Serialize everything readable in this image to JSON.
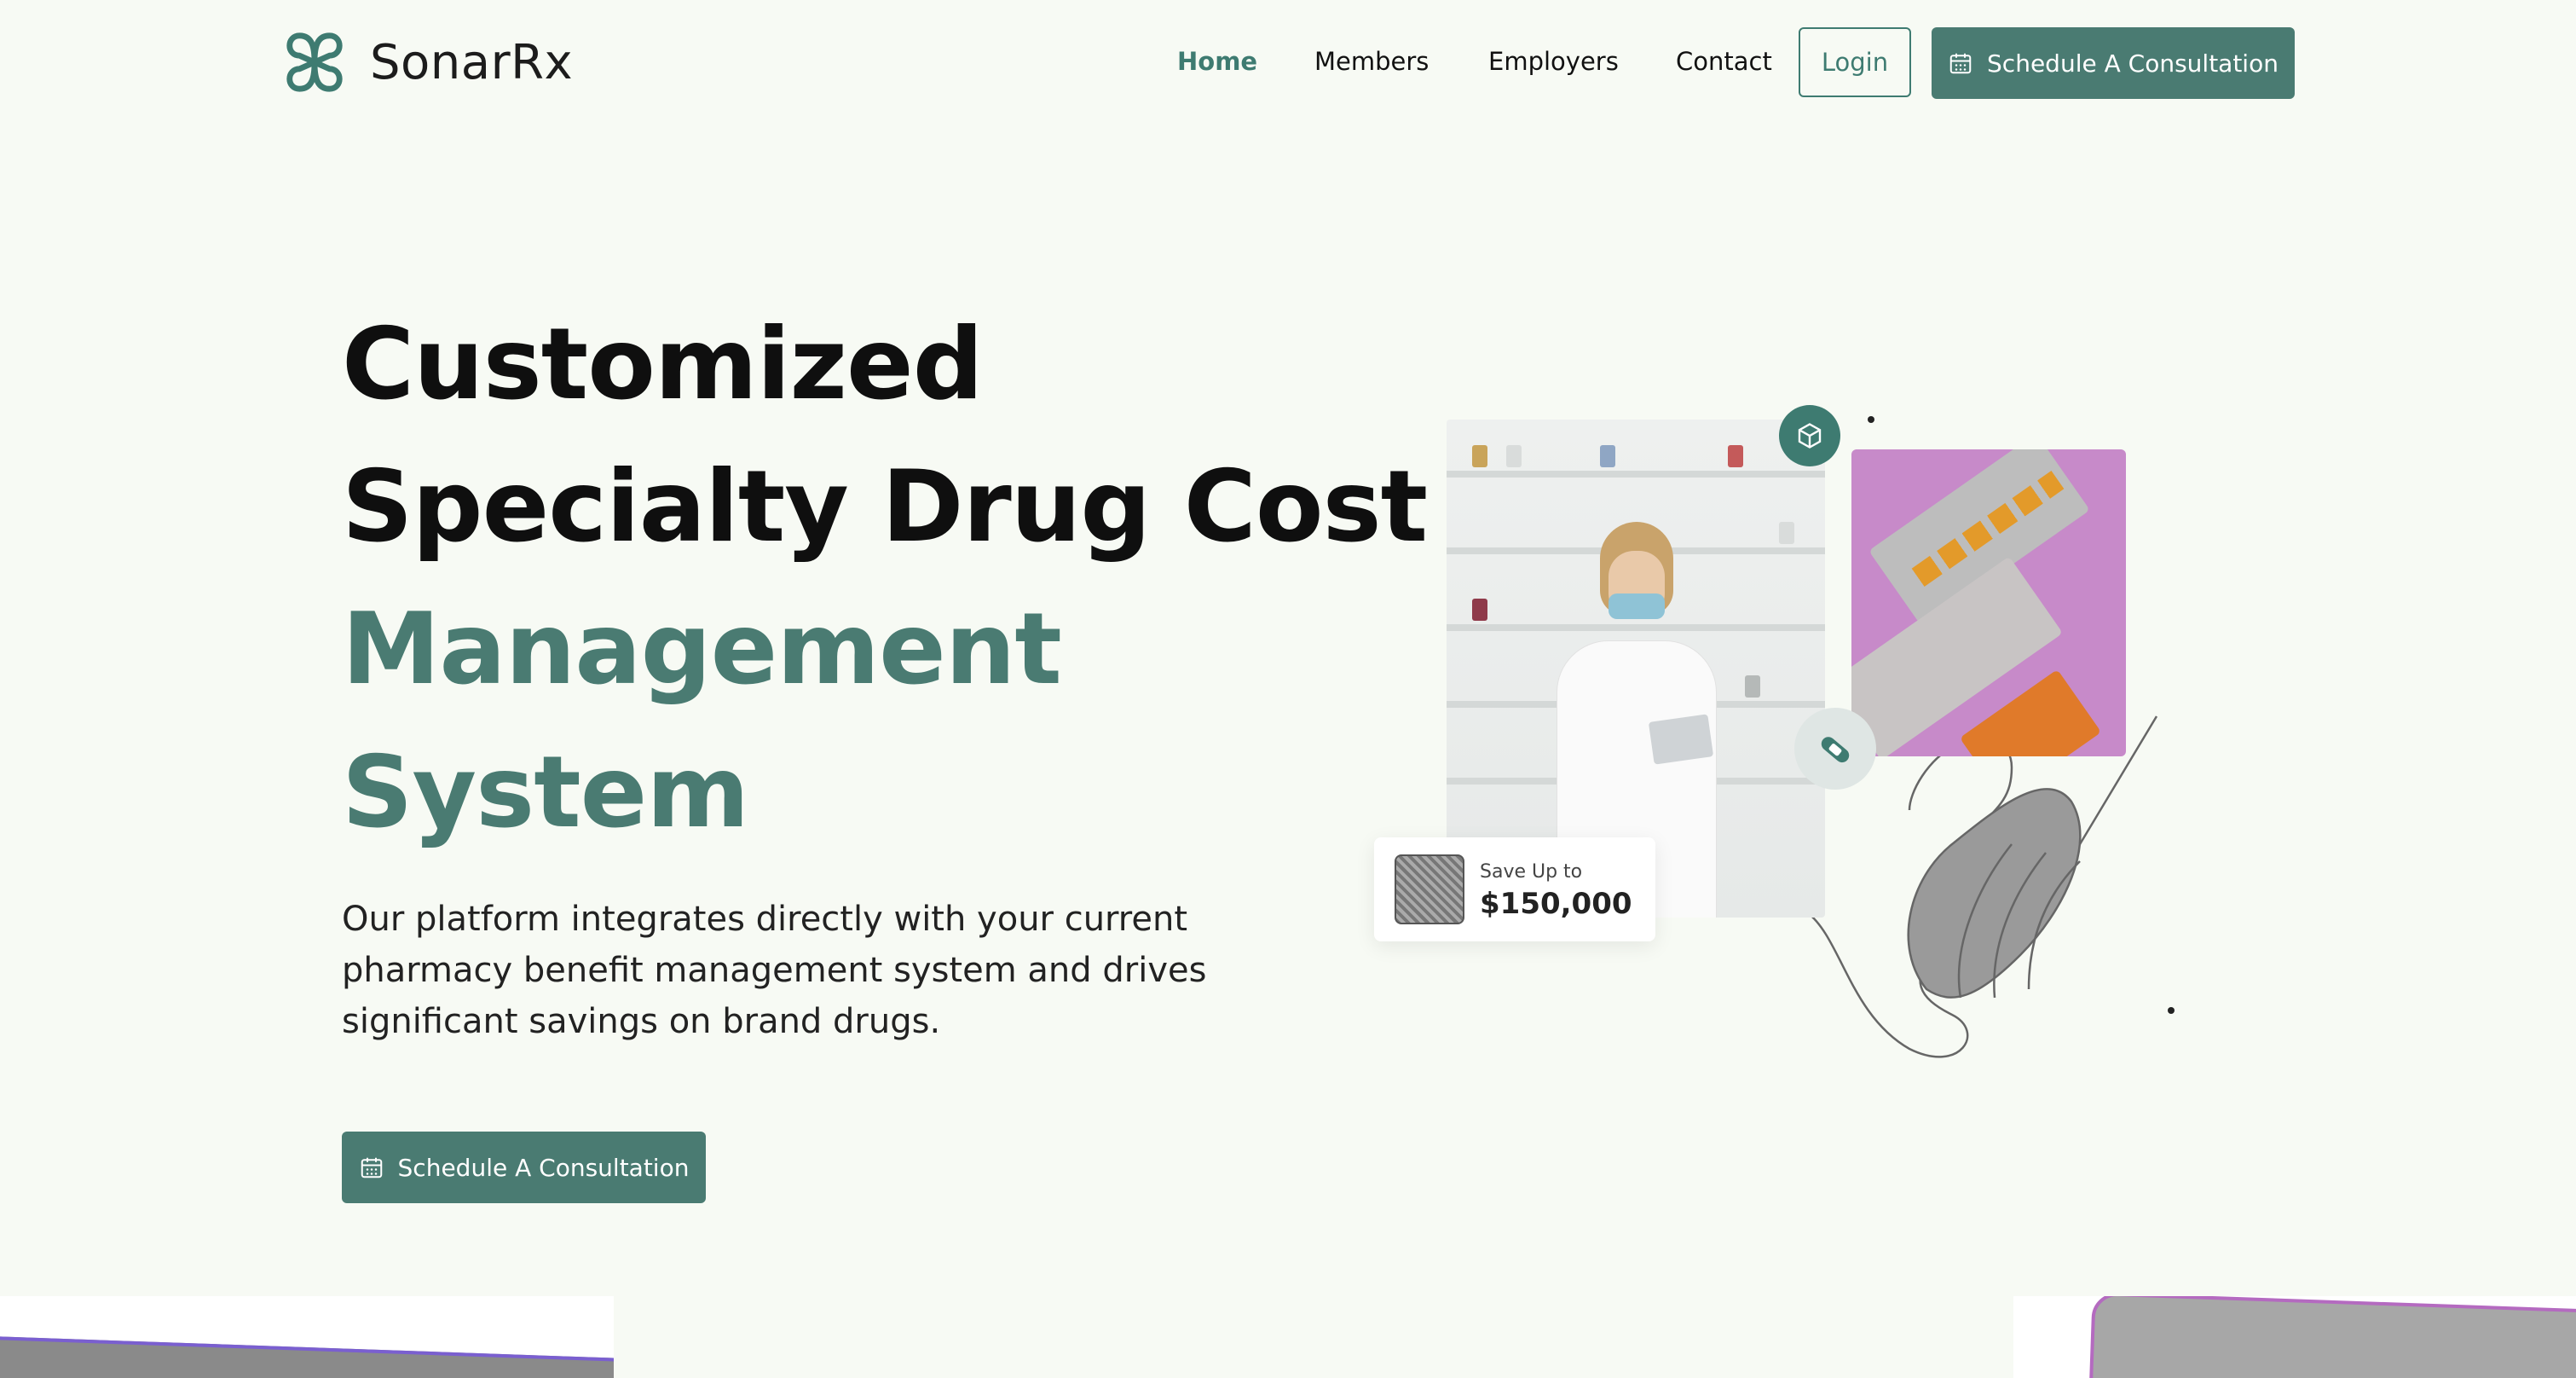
{
  "brand": {
    "name": "SonarRx",
    "accent": "#4a7b72",
    "background": "#f7faf4"
  },
  "nav": {
    "items": [
      {
        "label": "Home",
        "active": true
      },
      {
        "label": "Members",
        "active": false
      },
      {
        "label": "Employers",
        "active": false
      },
      {
        "label": "Contact",
        "active": false
      }
    ],
    "login_label": "Login",
    "cta_label": "Schedule A Consultation",
    "cta_icon": "calendar-icon"
  },
  "hero": {
    "headline_lines": [
      "Customized",
      "Specialty Drug Cost",
      "Management",
      "System"
    ],
    "description_lines": [
      "Our platform integrates directly with your current",
      "pharmacy benefit management system and drives",
      "significant savings on brand drugs."
    ],
    "cta_label": "Schedule A Consultation",
    "savings_card": {
      "label": "Save Up to",
      "value": "$150,000"
    }
  }
}
